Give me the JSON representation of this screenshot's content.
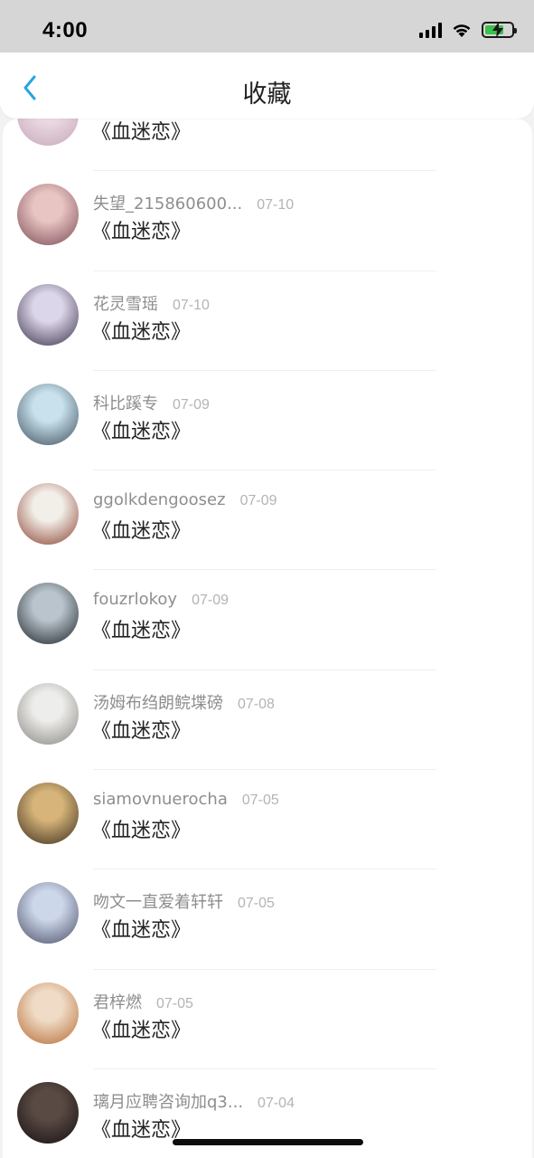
{
  "status_bar": {
    "time": "4:00"
  },
  "nav": {
    "title": "收藏"
  },
  "items": [
    {
      "user": "",
      "date": "",
      "title": "《血迷恋》",
      "avatar_colors": [
        "#e9d9e3",
        "#c7a8b5"
      ]
    },
    {
      "user": "失望_215860600...",
      "date": "07-10",
      "title": "《血迷恋》",
      "avatar_colors": [
        "#e8c4c2",
        "#7a4a55"
      ]
    },
    {
      "user": "花灵雪瑶",
      "date": "07-10",
      "title": "《血迷恋》",
      "avatar_colors": [
        "#dcd6ea",
        "#3a3048"
      ]
    },
    {
      "user": "科比蹊专",
      "date": "07-09",
      "title": "《血迷恋》",
      "avatar_colors": [
        "#c8e1ec",
        "#3d4e5e"
      ]
    },
    {
      "user": "ggolkdengoosez",
      "date": "07-09",
      "title": "《血迷恋》",
      "avatar_colors": [
        "#f2efe8",
        "#8a4030"
      ]
    },
    {
      "user": "fouzrlokoy",
      "date": "07-09",
      "title": "《血迷恋》",
      "avatar_colors": [
        "#b9c4cc",
        "#1c2228"
      ]
    },
    {
      "user": "汤姆布绉朗鲩堞磅",
      "date": "07-08",
      "title": "《血迷恋》",
      "avatar_colors": [
        "#ededeb",
        "#888580"
      ]
    },
    {
      "user": "siamovnuerocha",
      "date": "07-05",
      "title": "《血迷恋》",
      "avatar_colors": [
        "#d7b57a",
        "#3a2c1c"
      ]
    },
    {
      "user": "吻文一直爱着轩轩",
      "date": "07-05",
      "title": "《血迷恋》",
      "avatar_colors": [
        "#cdd7ea",
        "#4a4e66"
      ]
    },
    {
      "user": "君梓燃",
      "date": "07-05",
      "title": "《血迷恋》",
      "avatar_colors": [
        "#f0dcc6",
        "#b46a35"
      ]
    },
    {
      "user": "璃月应聘咨询加q3...",
      "date": "07-04",
      "title": "《血迷恋》",
      "avatar_colors": [
        "#5a4a44",
        "#141010"
      ]
    }
  ]
}
